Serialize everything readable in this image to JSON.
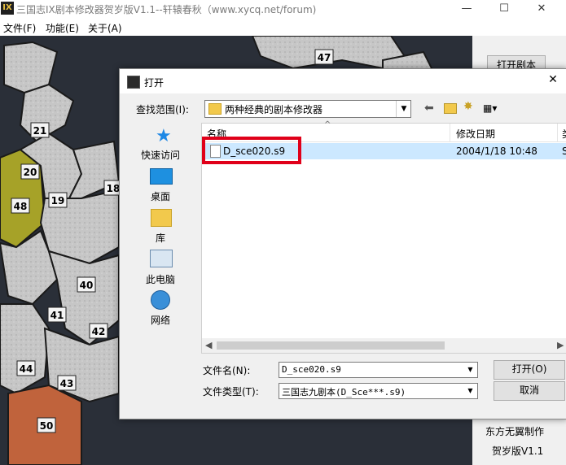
{
  "window": {
    "icon_text": "IX",
    "title": "三国志IX剧本修改器贺岁版V1.1--轩辕春秋（www.xycq.net/forum)",
    "minimize": "—",
    "maximize": "☐",
    "close": "✕"
  },
  "menubar": {
    "items": [
      "文件(F)",
      "功能(E)",
      "关于(A)"
    ]
  },
  "map": {
    "labels": [
      "47",
      "21",
      "20",
      "48",
      "19",
      "18",
      "40",
      "41",
      "42",
      "44",
      "43",
      "50"
    ]
  },
  "right_panel": {
    "open_script": "打开剧本",
    "credit_line1": "东方无翼制作",
    "credit_line2": "贺岁版V1.1"
  },
  "dialog": {
    "title": "打开",
    "close": "✕",
    "lookin_label": "查找范围(I):",
    "lookin_value": "两种经典的剧本修改器",
    "places": [
      "快速访问",
      "桌面",
      "库",
      "此电脑",
      "网络"
    ],
    "columns": {
      "name": "名称",
      "date": "修改日期",
      "extra": "类"
    },
    "files": [
      {
        "name": "D_sce020.s9",
        "date": "2004/1/18 10:48",
        "extra": "S"
      }
    ],
    "filename_label": "文件名(N):",
    "filename_value": "D_sce020.s9",
    "filetype_label": "文件类型(T):",
    "filetype_value": "三国志九剧本(D_Sce***.s9)",
    "open_button": "打开(O)",
    "cancel_button": "取消"
  },
  "colors": {
    "selection": "#cce8ff",
    "highlight_box": "#e0001a",
    "map_land": "#c9c9c9",
    "region48": "#a6a228",
    "region50": "#c0633c"
  }
}
